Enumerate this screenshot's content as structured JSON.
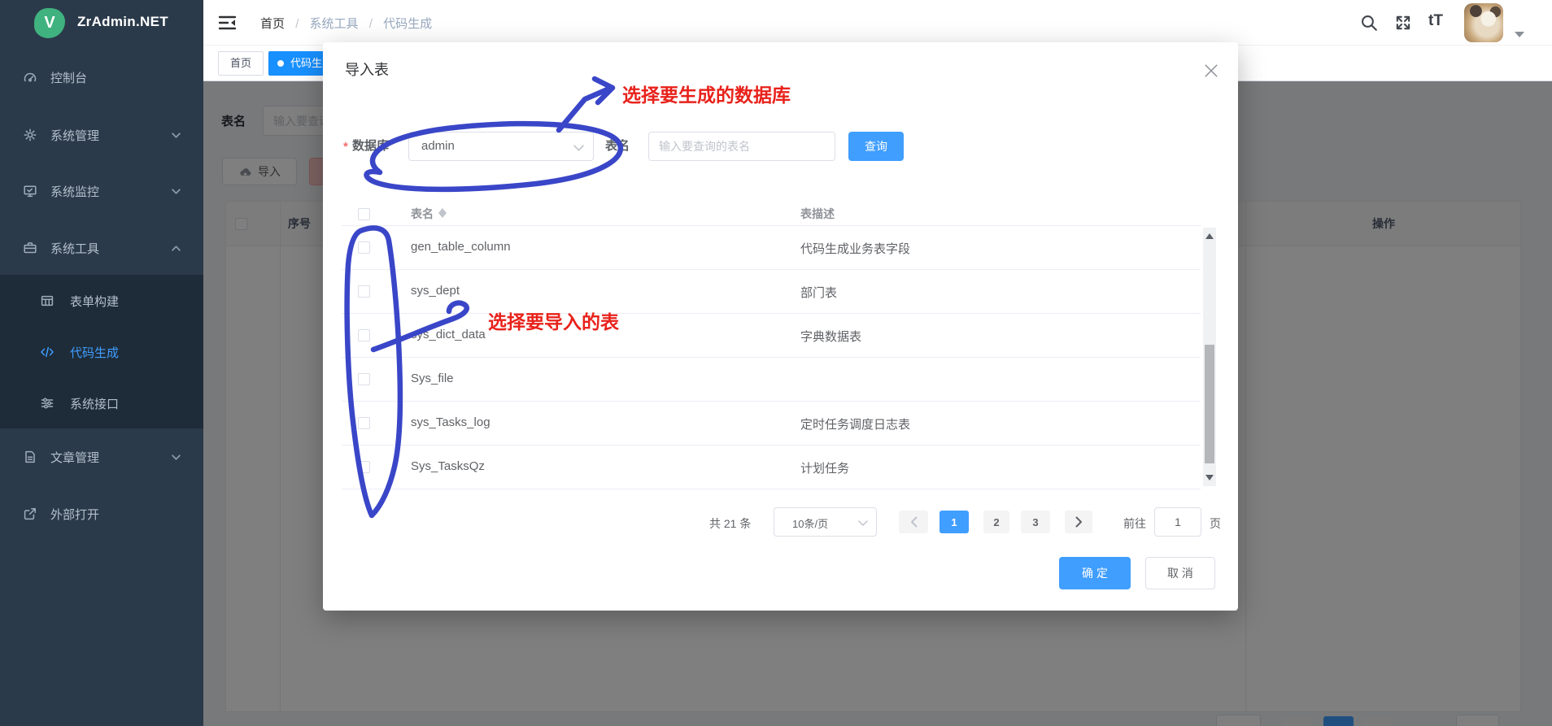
{
  "brand": {
    "name": "ZrAdmin.NET",
    "logo_letter": "V"
  },
  "sidebar": {
    "items": [
      {
        "label": "控制台"
      },
      {
        "label": "系统管理"
      },
      {
        "label": "系统监控"
      },
      {
        "label": "系统工具"
      },
      {
        "label": "表单构建"
      },
      {
        "label": "代码生成"
      },
      {
        "label": "系统接口"
      },
      {
        "label": "文章管理"
      },
      {
        "label": "外部打开"
      }
    ]
  },
  "navbar": {
    "breadcrumb": {
      "home": "首页",
      "section": "系统工具",
      "page": "代码生成",
      "separator": "/"
    },
    "font_icon_label": "tT"
  },
  "tags": {
    "home": "首页",
    "active": "代码生成"
  },
  "page": {
    "search_label": "表名",
    "search_placeholder": "输入要查询的表名",
    "import_button": "导入",
    "table": {
      "seq_header": "序号",
      "action_header": "操作"
    }
  },
  "modal": {
    "title": "导入表",
    "form": {
      "required_mark": "*",
      "db_label": "数据库",
      "db_value": "admin",
      "name_label": "表名",
      "name_placeholder": "输入要查询的表名",
      "search_button": "查询"
    },
    "table": {
      "name_header": "表名",
      "desc_header": "表描述",
      "rows": [
        {
          "name": "gen_table_column",
          "desc": "代码生成业务表字段"
        },
        {
          "name": "sys_dept",
          "desc": "部门表"
        },
        {
          "name": "sys_dict_data",
          "desc": "字典数据表"
        },
        {
          "name": "Sys_file",
          "desc": ""
        },
        {
          "name": "sys_Tasks_log",
          "desc": "定时任务调度日志表"
        },
        {
          "name": "Sys_TasksQz",
          "desc": "计划任务"
        }
      ]
    },
    "pagination": {
      "total": "共 21 条",
      "page_size": "10条/页",
      "pages": [
        "1",
        "2",
        "3"
      ],
      "active_page": "1",
      "goto_label": "前往",
      "goto_value": "1",
      "goto_unit": "页"
    },
    "footer": {
      "confirm": "确 定",
      "cancel": "取 消"
    }
  },
  "annotations": {
    "db_note": "选择要生成的数据库",
    "table_note": "选择要导入的表"
  },
  "colors": {
    "primary": "#409eff",
    "tag_active": "#1890ff",
    "marker_blue": "#3a46c8",
    "annotation_red": "#e8221b",
    "sidebar_bg": "#2b3a4a",
    "submenu_bg": "#1e2c3a"
  }
}
